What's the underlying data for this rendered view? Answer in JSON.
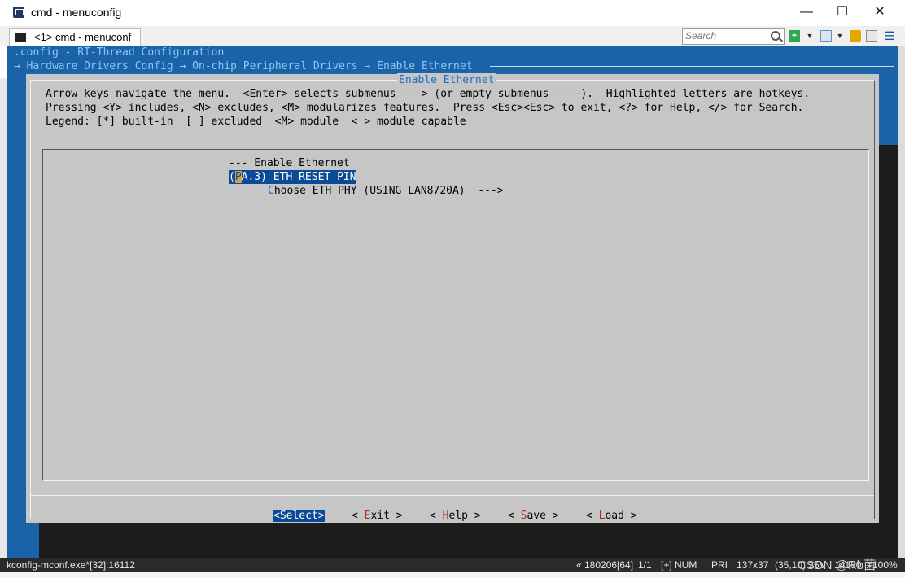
{
  "window": {
    "title": "cmd - menuconfig",
    "controls": {
      "minimize": "—",
      "maximize": "☐",
      "close": "✕"
    }
  },
  "tab": {
    "label": "<1> cmd - menuconf"
  },
  "toolbar": {
    "search_placeholder": "Search",
    "icons": [
      "add-icon",
      "dropdown-icon",
      "view-icon",
      "dropdown-icon",
      "lock-icon",
      "panel-icon",
      "menu-icon"
    ]
  },
  "console": {
    "line1": ".config - RT-Thread Configuration",
    "line2": "→ Hardware Drivers Config → On-chip Peripheral Drivers → Enable Ethernet"
  },
  "dialog": {
    "title": "Enable Ethernet",
    "help": [
      "Arrow keys navigate the menu.  <Enter> selects submenus ---> (or empty submenus ----).  Highlighted letters are hotkeys.",
      "Pressing <Y> includes, <N> excludes, <M> modularizes features.  Press <Esc><Esc> to exit, <?> for Help, </> for Search.",
      "Legend: [*] built-in  [ ] excluded  <M> module  < > module capable"
    ],
    "menu": {
      "header": "--- Enable Ethernet",
      "item1": {
        "open": "(",
        "hotkey": "P",
        "value_rest": "A.3)",
        "label_hotkey": "E",
        "label_rest": "TH RESET PIN"
      },
      "item2": {
        "hotkey": "C",
        "rest": "hoose ETH PHY (USING LAN8720A)  --->"
      }
    },
    "buttons": {
      "select": "<Select>",
      "exit": {
        "pre": "< ",
        "hotkey": "E",
        "rest": "xit >"
      },
      "help": {
        "pre": "< ",
        "hotkey": "H",
        "rest": "elp >"
      },
      "save": {
        "pre": "< ",
        "hotkey": "S",
        "rest": "ave >"
      },
      "load": {
        "pre": "< ",
        "hotkey": "L",
        "rest": "oad >"
      }
    }
  },
  "statusbar": {
    "process": "kconfig-mconf.exe*[32]:16112",
    "build": "« 180206[64]",
    "page": "1/1",
    "plus": "[+] NUM",
    "pri": "PRI",
    "size": "137x37",
    "pos": "(35,10) 25V",
    "num": "14180",
    "pct": "100%",
    "watermark": "CSDN @Rb菌"
  }
}
